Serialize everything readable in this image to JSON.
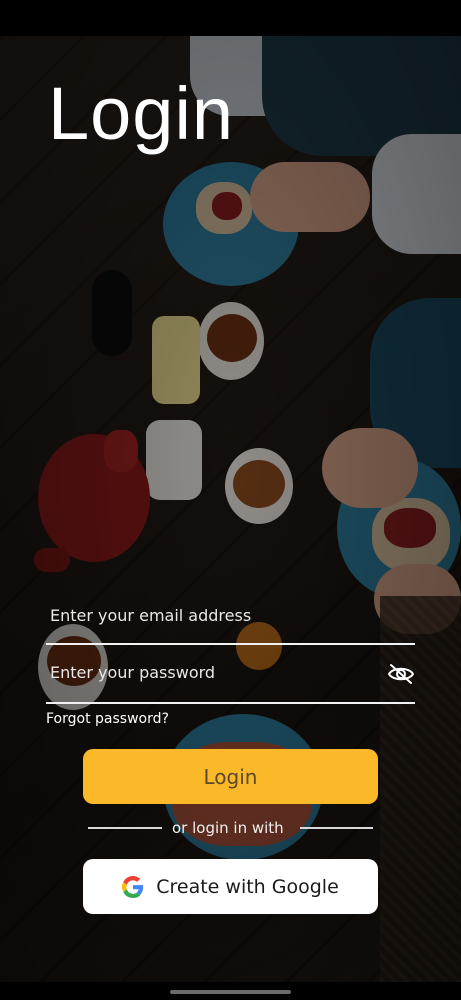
{
  "screen": {
    "title": "Login",
    "email_placeholder": "Enter your email address",
    "password_placeholder": "Enter your password",
    "forgot_password": "Forgot password?",
    "login_button": "Login",
    "divider_text": "or login in with",
    "google_button": "Create with Google"
  },
  "icons": {
    "password_toggle": "eye-off-icon",
    "google": "google-icon"
  },
  "colors": {
    "accent": "#fbb829",
    "google_button_bg": "#ffffff",
    "text_on_dark": "#ffffff"
  }
}
